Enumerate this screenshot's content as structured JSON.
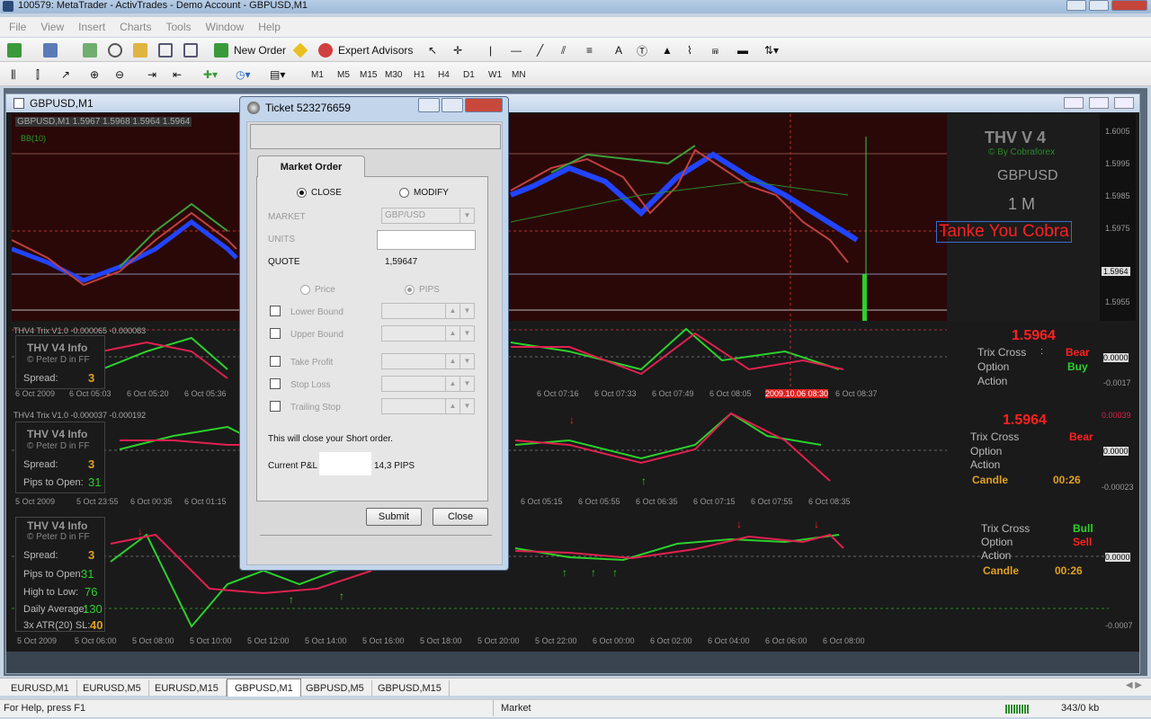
{
  "window": {
    "title": "100579: MetaTrader - ActivTrades - Demo Account - GBPUSD,M1"
  },
  "menu": [
    "File",
    "View",
    "Insert",
    "Charts",
    "Tools",
    "Window",
    "Help"
  ],
  "toolbar": {
    "new_order": "New Order",
    "expert_advisors": "Expert Advisors",
    "text_tool": "A",
    "timeframes": [
      "M1",
      "M5",
      "M15",
      "M30",
      "H1",
      "H4",
      "D1",
      "W1",
      "MN"
    ]
  },
  "chart": {
    "title": "GBPUSD,M1",
    "ohlc_label": "GBPUSD,M1  1.5967 1.5968 1.5964 1.5964",
    "bb_label": "BB(10)",
    "thv_title": "THV V 4",
    "thv_sub": "© By Cobraforex",
    "symbol": "GBPUSD",
    "tf": "1 M",
    "banner": "Tanke You Cobra",
    "price_ticks": [
      "1.6005",
      "1.5995",
      "1.5985",
      "1.5975",
      "1.5964",
      "1.5955"
    ],
    "trix1": {
      "label": "THV4 Trix V1.0 -0.000065 -0.000083",
      "price": "1.5964",
      "trix": "Trix Cross",
      ":": ":",
      "trix_val": "Bear",
      "option": "Option",
      "option_val": "Buy",
      "action": "Action",
      "ticks": [
        "0.0000",
        "-0.0017"
      ],
      "times": [
        "6 Oct 2009",
        "6 Oct 05:03",
        "6 Oct 05:20",
        "6 Oct 05:36",
        "6 Oct 07:16",
        "6 Oct 07:33",
        "6 Oct 07:49",
        "6 Oct 08:05",
        "2009.10.06 08:30",
        "6 Oct 08:37"
      ],
      "info_title": "THV  V4 Info",
      "info_sub": "© Peter D in FF",
      "spread": "Spread:",
      "spread_val": "3"
    },
    "trix2": {
      "label": "THV4 Trix V1.0 -0.000037 -0.000192",
      "price": "1.5964",
      "trix_val": "Bear",
      "candle": "Candle",
      "candle_val": "00:26",
      "ticks": [
        "0.00039",
        "0.0000",
        "-0.00023"
      ],
      "times": [
        "5 Oct 2009",
        "5 Oct 23:55",
        "6 Oct 00:35",
        "6 Oct 01:15",
        "6 Oct 05:15",
        "6 Oct 05:55",
        "6 Oct 06:35",
        "6 Oct 07:15",
        "6 Oct 07:55",
        "6 Oct 08:35"
      ],
      "pips_open": "Pips to Open:",
      "pips_val": "31"
    },
    "trix3": {
      "trix_val": "Bull",
      "option_val": "Sell",
      "candle_val": "00:26",
      "ticks": [
        "0.0000",
        "-0.0007"
      ],
      "times": [
        "5 Oct 2009",
        "5 Oct 06:00",
        "5 Oct 08:00",
        "5 Oct 10:00",
        "5 Oct 12:00",
        "5 Oct 14:00",
        "5 Oct 16:00",
        "5 Oct 18:00",
        "5 Oct 20:00",
        "5 Oct 22:00",
        "6 Oct 00:00",
        "6 Oct 02:00",
        "6 Oct 04:00",
        "6 Oct 06:00",
        "6 Oct 08:00"
      ],
      "hl": "High to Low:",
      "hl_val": "76",
      "daily": "Daily Average:",
      "daily_val": "130",
      "atr": "3x ATR(20) SL:",
      "atr_val": "40"
    }
  },
  "ticket": {
    "title": "Ticket 523276659",
    "tab": "Market Order",
    "close": "CLOSE",
    "modify": "MODIFY",
    "market_label": "MARKET",
    "market_val": "GBP/USD",
    "units_label": "UNITS",
    "quote_label": "QUOTE",
    "quote_val": "1,59647",
    "price": "Price",
    "pips": "PIPS",
    "lower": "Lower Bound",
    "upper": "Upper Bound",
    "tp": "Take Profit",
    "sl": "Stop Loss",
    "ts": "Trailing Stop",
    "note": "This will close your Short order.",
    "pl_label": "Current P&L",
    "pl_pips": "14,3 PIPS",
    "submit": "Submit",
    "closebtn": "Close"
  },
  "tabs": [
    "EURUSD,M1",
    "EURUSD,M5",
    "EURUSD,M15",
    "GBPUSD,M1",
    "GBPUSD,M5",
    "GBPUSD,M15"
  ],
  "status": {
    "help": "For Help, press F1",
    "market": "Market",
    "traffic": "343/0 kb"
  }
}
